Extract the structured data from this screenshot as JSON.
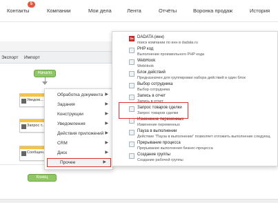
{
  "nav": {
    "badge": "5",
    "items": [
      "Контакты",
      "Компании",
      "Мои дела",
      "Лента",
      "Отчёты",
      "Воронка продаж",
      "История"
    ]
  },
  "toolbar": {
    "export": "Экспорт",
    "import": "Импорт"
  },
  "flow": {
    "start": "Начало",
    "end": "Конец",
    "blocks": [
      "Уведом...",
      "Запрос т...",
      "Сообщен... ленту"
    ]
  },
  "context_menu": [
    "Обработка документа",
    "Задания",
    "Конструкции",
    "Уведомления",
    "Действия приложений",
    "CRM",
    "Диск",
    "Прочее"
  ],
  "submenu": [
    {
      "title": "DADATA (инн)",
      "desc": "поиск компании по инн в dadata.ru",
      "icon": "dadata-icon"
    },
    {
      "title": "PHP код",
      "desc": "Выполнение произвольного PHP кода",
      "icon": "php-icon"
    },
    {
      "title": "WebHook",
      "desc": "WebHook",
      "icon": "webhook-icon"
    },
    {
      "title": "Блок действий",
      "desc": "Предназначен для группировки набора действий в один блок",
      "icon": "action-block-icon"
    },
    {
      "title": "Выбор сотрудника",
      "desc": "Выбор сотрудника",
      "icon": "employee-select-icon"
    },
    {
      "title": "Запись в отчет",
      "desc": "Запись в отчет",
      "icon": "report-icon"
    },
    {
      "title": "Запрос товаров сделки",
      "desc": "Запрос товаров сделки",
      "icon": "deal-products-icon"
    },
    {
      "title": "Изменение переменных",
      "desc": "Изменение переменных",
      "icon": "variables-icon"
    },
    {
      "title": "Пауза в выполнении",
      "desc": "Действие \"Пауза в выполнении\" позволяет отложить выполнение следующ",
      "icon": "pause-icon"
    },
    {
      "title": "Прерывание процесса",
      "desc": "Прерывание выполнения бизнес-процесса",
      "icon": "stop-icon"
    },
    {
      "title": "Создание группы",
      "desc": "Создание рабочей группы",
      "icon": "group-icon"
    }
  ],
  "colors": {
    "accent_red": "#d9302c",
    "start_green": "#8fc766",
    "block_yellow": "#f5c542"
  }
}
